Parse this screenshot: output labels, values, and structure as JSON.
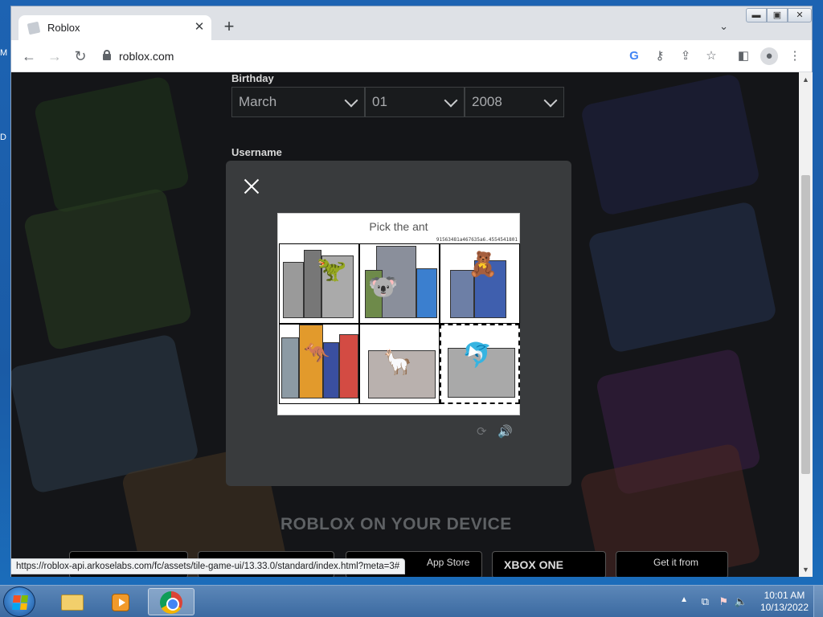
{
  "browser": {
    "tab_title": "Roblox",
    "url": "roblox.com",
    "status_url": "https://roblox-api.arkoselabs.com/fc/assets/tile-game-ui/13.33.0/standard/index.html?meta=3#"
  },
  "page": {
    "birthday_label": "Birthday",
    "month": "March",
    "day": "01",
    "year": "2008",
    "username_label": "Username",
    "device_heading": "ROBLOX ON YOUR DEVICE",
    "stores": [
      "App Store",
      "XBOX ONE",
      "Get it from"
    ]
  },
  "captcha": {
    "prompt": "Pick the ant",
    "id_text": "91563481a467635a6.4554541801",
    "selected_tile": 6
  },
  "taskbar": {
    "time": "10:01 AM",
    "date": "10/13/2022"
  },
  "colors": {
    "modal_bg": "#393b3d",
    "page_bg": "#232527",
    "taskbar": "#3b6aa1"
  }
}
